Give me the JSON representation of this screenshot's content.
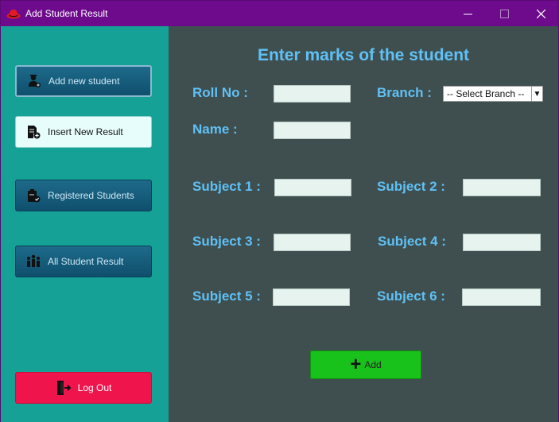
{
  "window": {
    "title": "Add Student Result",
    "controls": {
      "minimize": "–",
      "maximize": "☐",
      "close": "✕"
    }
  },
  "sidebar": {
    "items": [
      {
        "label": "Add new student",
        "icon": "student-icon"
      },
      {
        "label": "Insert New Result",
        "icon": "document-add-icon"
      },
      {
        "label": "Registered Students",
        "icon": "clipboard-check-icon"
      },
      {
        "label": "All Student Result",
        "icon": "group-icon"
      }
    ],
    "logout": {
      "label": "Log Out",
      "icon": "logout-icon"
    }
  },
  "main": {
    "heading": "Enter marks of the student",
    "labels": {
      "roll_no": "Roll No :",
      "branch": "Branch :",
      "name": "Name :",
      "subject1": "Subject 1 :",
      "subject2": "Subject 2 :",
      "subject3": "Subject 3 :",
      "subject4": "Subject 4 :",
      "subject5": "Subject 5 :",
      "subject6": "Subject 6 :"
    },
    "branch_select": {
      "selected": "-- Select Branch --"
    },
    "add_button": "Add"
  },
  "colors": {
    "titlebar": "#6d0b8c",
    "sidebar": "#15a195",
    "main_bg": "#3f4f4f",
    "label": "#5fc1f6",
    "add_button": "#19c21b",
    "logout_button": "#f0144d"
  }
}
